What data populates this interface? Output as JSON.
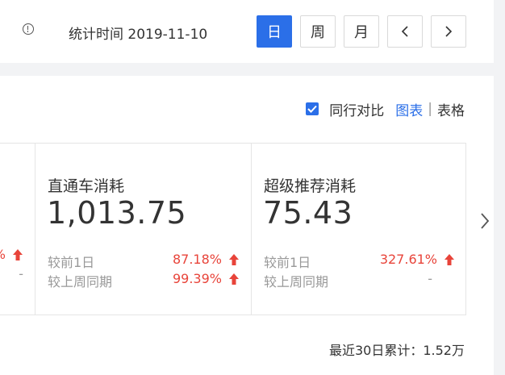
{
  "header": {
    "stat_time_label": "统计时间 2019-11-10",
    "range_buttons": [
      "日",
      "周",
      "月"
    ],
    "active_range": "日"
  },
  "toolbar": {
    "compare_label": "同行对比",
    "compare_checked": true,
    "view_chart": "图表",
    "view_divider": "|",
    "view_table": "表格"
  },
  "cards": {
    "partial": {
      "day_change": "%",
      "week_change": "-"
    },
    "items": [
      {
        "title": "直通车消耗",
        "value": "1,013.75",
        "day_label": "较前1日",
        "day_change": "87.18%",
        "week_label": "较上周同期",
        "week_change": "99.39%"
      },
      {
        "title": "超级推荐消耗",
        "value": "75.43",
        "day_label": "较前1日",
        "day_change": "327.61%",
        "week_label": "较上周同期",
        "week_change": "-"
      }
    ]
  },
  "footer": {
    "total_label": "最近30日累计：1.52万"
  },
  "colors": {
    "accent": "#2b6fe8",
    "increase": "#e8443a",
    "muted": "#999999"
  }
}
